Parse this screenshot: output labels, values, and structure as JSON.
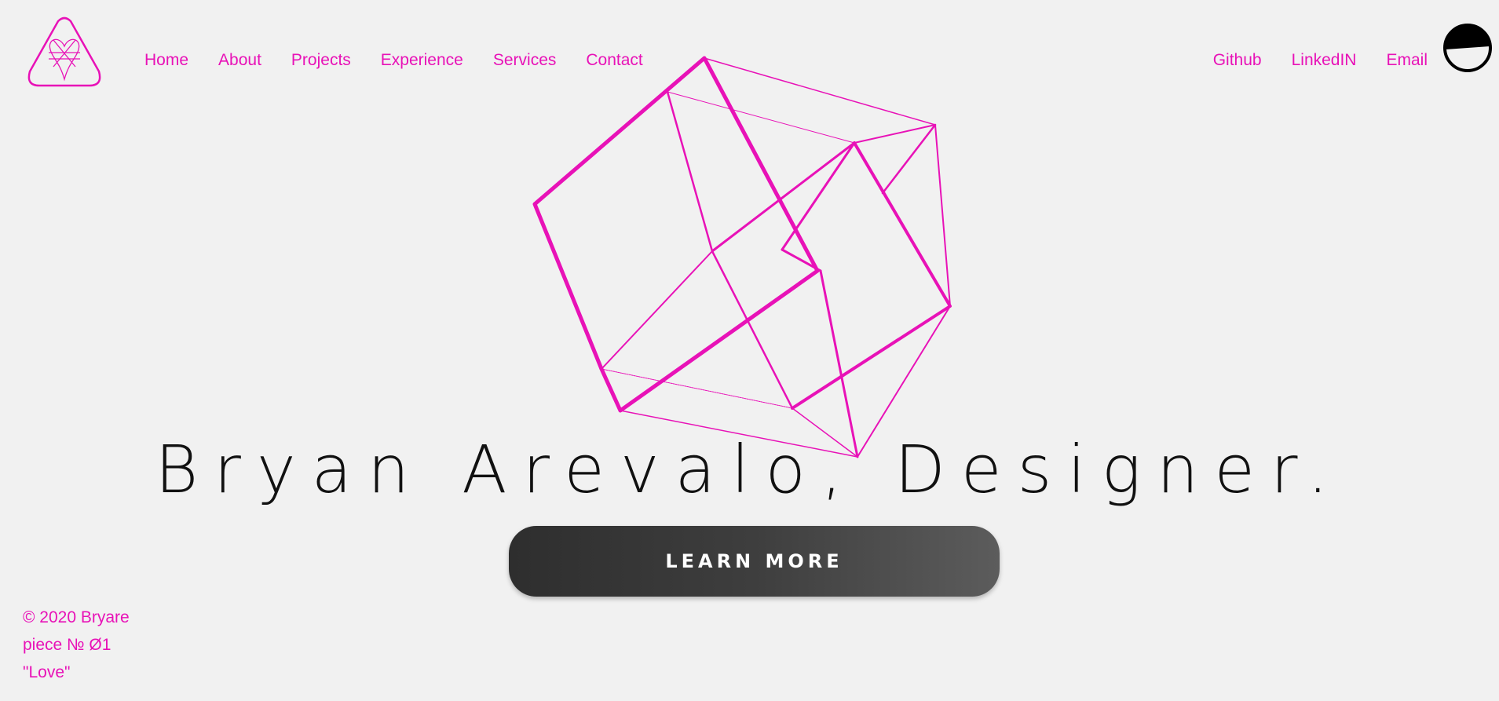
{
  "brand": {
    "logo_icon": "heart-triangle-logo-icon",
    "accent_color": "#e812b7"
  },
  "nav_left": {
    "home": "Home",
    "about": "About",
    "projects": "Projects",
    "experience": "Experience",
    "services": "Services",
    "contact": "Contact"
  },
  "nav_right": {
    "github": "Github",
    "linkedin": "LinkedIN",
    "email": "Email"
  },
  "theme_toggle": {
    "icon": "half-circle-theme-icon"
  },
  "hero": {
    "cube_icon": "wireframe-hypercube",
    "title": "Bryan Arevalo, Designer.",
    "cta_label": "LEARN MORE"
  },
  "footer": {
    "copyright": "© 2020 Bryare",
    "piece": "piece №  Ø1",
    "name": "\"Love\""
  }
}
